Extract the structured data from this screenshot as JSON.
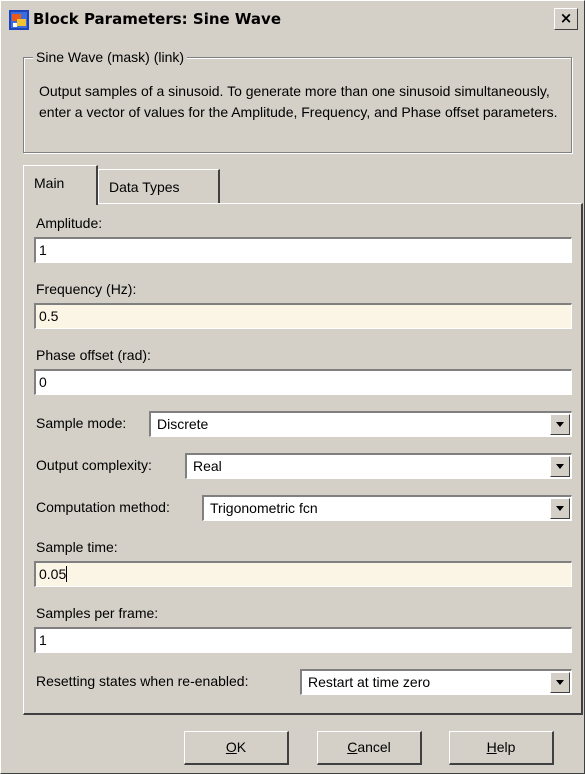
{
  "window": {
    "title": "Block Parameters: Sine Wave",
    "close_glyph": "×",
    "icon": "simulink-block-icon"
  },
  "group": {
    "legend": "Sine Wave (mask) (link)",
    "description": "Output samples of a sinusoid.  To generate more than one sinusoid simultaneously, enter a vector of values for the Amplitude, Frequency, and Phase offset parameters."
  },
  "tabs": [
    {
      "label": "Main",
      "active": true
    },
    {
      "label": "Data Types",
      "active": false
    }
  ],
  "params": {
    "amplitude": {
      "label": "Amplitude:",
      "value": "1"
    },
    "frequency": {
      "label": "Frequency (Hz):",
      "value": "0.5"
    },
    "phase": {
      "label": "Phase offset (rad):",
      "value": "0"
    },
    "sample_mode": {
      "label": "Sample mode:",
      "value": "Discrete"
    },
    "output_complexity": {
      "label": "Output complexity:",
      "value": "Real"
    },
    "computation_method": {
      "label": "Computation method:",
      "value": "Trigonometric fcn"
    },
    "sample_time": {
      "label": "Sample time:",
      "value": "0.05"
    },
    "samples_per_frame": {
      "label": "Samples per frame:",
      "value": "1"
    },
    "resetting_states": {
      "label": "Resetting states when re-enabled:",
      "value": "Restart at time zero"
    }
  },
  "buttons": {
    "ok": {
      "mnemonic": "O",
      "rest": "K"
    },
    "cancel": {
      "mnemonic": "C",
      "rest": "ancel"
    },
    "help": {
      "mnemonic": "H",
      "rest": "elp"
    }
  },
  "colors": {
    "dialog_bg": "#d4d0c8",
    "highlighted_field_bg": "#fbf5e6"
  }
}
